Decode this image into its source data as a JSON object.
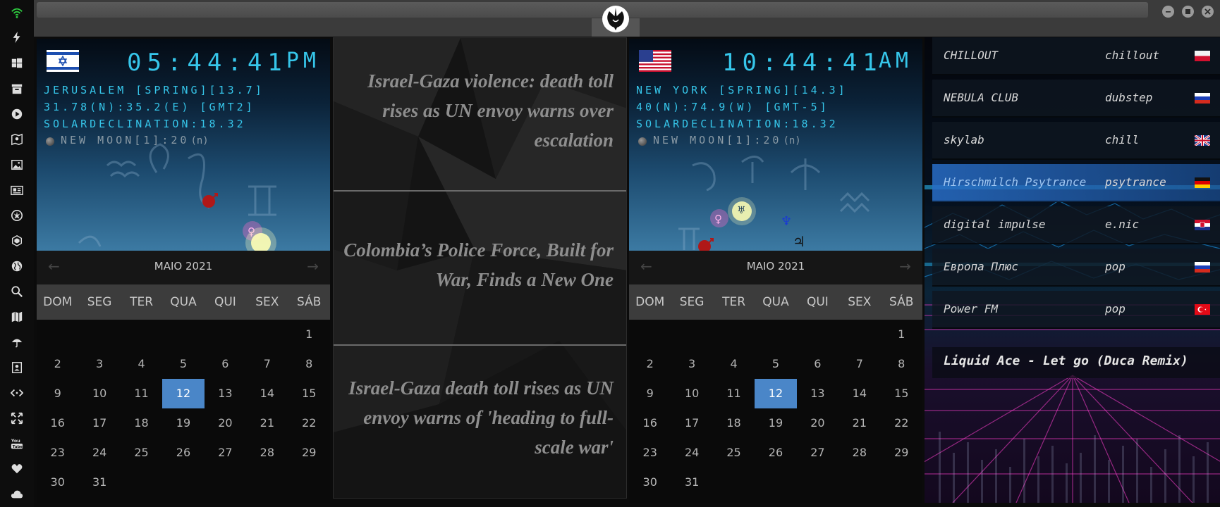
{
  "colors": {
    "accent_lcd": "#36c6ea",
    "today": "#4a86c8",
    "active_station": "#2a6ec8"
  },
  "sidebar": {
    "items": [
      {
        "name": "wifi-icon",
        "color": "#2ecc40"
      },
      {
        "name": "lightning-icon"
      },
      {
        "name": "windows-icon"
      },
      {
        "name": "archive-icon"
      },
      {
        "name": "play-icon"
      },
      {
        "name": "map-pin-icon"
      },
      {
        "name": "image-icon"
      },
      {
        "name": "newspaper-icon"
      },
      {
        "name": "rebel-icon"
      },
      {
        "name": "hexagon-icon"
      },
      {
        "name": "globe-icon"
      },
      {
        "name": "search-icon"
      },
      {
        "name": "map-icon"
      },
      {
        "name": "umbrella-icon"
      },
      {
        "name": "contact-icon"
      },
      {
        "name": "code-icon"
      },
      {
        "name": "expand-icon"
      },
      {
        "name": "youtube-icon"
      },
      {
        "name": "heart-icon"
      },
      {
        "name": "cloud-icon"
      }
    ]
  },
  "titlebar": {
    "logo": "rebel-alliance-icon",
    "buttons": [
      "minimize-icon",
      "maximize-icon",
      "close-icon"
    ]
  },
  "clocks": [
    {
      "flag": "israel-flag",
      "time": "05:44:41",
      "ampm": "PM",
      "location": "JERUSALEM [SPRING][13.7]",
      "coords": "31.78(N):35.2(E) [GMT2]",
      "declination": "SOLARDECLINATION:18.32",
      "moon": "NEW MOON[1]:20",
      "moon_suffix": "(n)"
    },
    {
      "flag": "usa-flag",
      "time": "10:44:41",
      "ampm": "AM",
      "location": "NEW YORK [SPRING][14.3]",
      "coords": "40(N):74.9(W) [GMT-5]",
      "declination": "SOLARDECLINATION:18.32",
      "moon": "NEW MOON[1]:20",
      "moon_suffix": "(n)"
    }
  ],
  "calendar": {
    "title": "MAIO 2021",
    "prev": "←",
    "next": "→",
    "weekdays": [
      "DOM",
      "SEG",
      "TER",
      "QUA",
      "QUI",
      "SEX",
      "SÁB"
    ],
    "weeks": [
      [
        "",
        "",
        "",
        "",
        "",
        "",
        "1"
      ],
      [
        "2",
        "3",
        "4",
        "5",
        "6",
        "7",
        "8"
      ],
      [
        "9",
        "10",
        "11",
        "12",
        "13",
        "14",
        "15"
      ],
      [
        "16",
        "17",
        "18",
        "19",
        "20",
        "21",
        "22"
      ],
      [
        "23",
        "24",
        "25",
        "26",
        "27",
        "28",
        "29"
      ],
      [
        "30",
        "31",
        "",
        "",
        "",
        "",
        ""
      ]
    ],
    "today": "12"
  },
  "news": [
    {
      "headline": "Israel-Gaza violence: death toll rises as UN envoy warns over escalation"
    },
    {
      "headline": "Colombia’s Police Force, Built for War, Finds a New One"
    },
    {
      "headline": "Israel-Gaza death toll rises as UN envoy warns of 'heading to full-scale war'"
    }
  ],
  "radio": {
    "stations": [
      {
        "name": "CHILLOUT",
        "genre": "chillout",
        "flag": "poland-flag",
        "active": false
      },
      {
        "name": "NEBULA CLUB",
        "genre": "dubstep",
        "flag": "russia-flag",
        "active": false
      },
      {
        "name": "skylab",
        "genre": "chill",
        "flag": "uk-flag",
        "active": false
      },
      {
        "name": "Hirschmilch Psytrance",
        "genre": "psytrance",
        "flag": "germany-flag",
        "active": true
      },
      {
        "name": "digital impulse",
        "genre": "e.nic",
        "flag": "croatia-flag",
        "active": false
      },
      {
        "name": "Европа Плюс",
        "genre": "pop",
        "flag": "russia-flag",
        "active": false
      },
      {
        "name": "Power FM",
        "genre": "pop",
        "flag": "turkey-flag",
        "active": false
      }
    ],
    "now_playing": "Liquid Ace - Let go (Duca Remix)"
  }
}
